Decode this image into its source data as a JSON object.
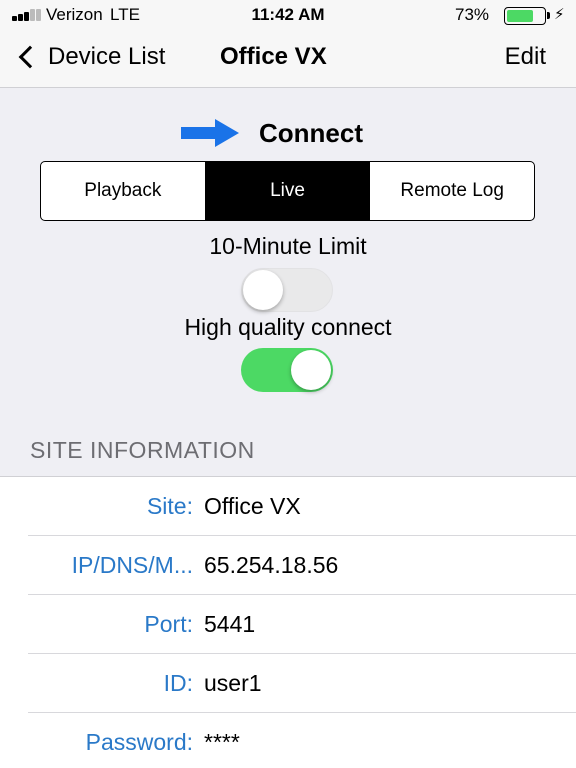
{
  "status_bar": {
    "carrier": "Verizon",
    "network": "LTE",
    "time": "11:42 AM",
    "battery_percent": "73%",
    "battery_level": 0.73,
    "charging_icon": "bolt-icon"
  },
  "nav": {
    "back_label": "Device List",
    "title": "Office VX",
    "edit_label": "Edit"
  },
  "connect": {
    "label": "Connect",
    "arrow_color": "#1a73e8"
  },
  "mode_tabs": [
    {
      "label": "Playback",
      "active": false
    },
    {
      "label": "Live",
      "active": true
    },
    {
      "label": "Remote Log",
      "active": false
    }
  ],
  "options": {
    "limit_label": "10-Minute Limit",
    "limit_on": false,
    "hq_label": "High quality connect",
    "hq_on": true
  },
  "site_info": {
    "header": "SITE INFORMATION",
    "rows": [
      {
        "key": "Site:",
        "value": "Office VX"
      },
      {
        "key": "IP/DNS/M...",
        "value": "65.254.18.56"
      },
      {
        "key": "Port:",
        "value": "5441"
      },
      {
        "key": "ID:",
        "value": "user1"
      },
      {
        "key": "Password:",
        "value": "****"
      }
    ]
  },
  "colors": {
    "accent": "#2a79c8",
    "toggle_on": "#4cd964",
    "background": "#efeff4"
  }
}
